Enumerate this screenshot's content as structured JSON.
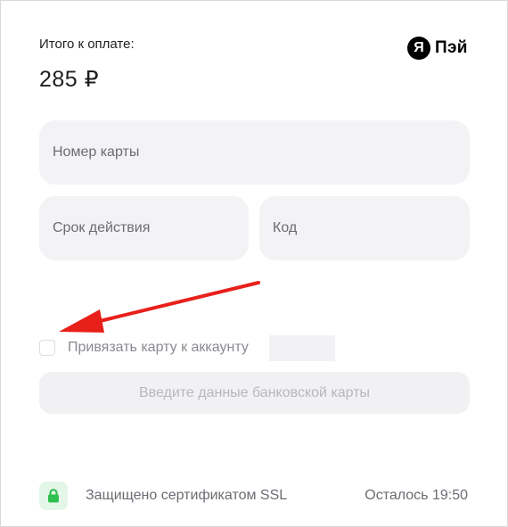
{
  "payment": {
    "amount_label": "Итого к оплате:",
    "amount_value": "285 ₽"
  },
  "brand": {
    "logo_letter": "Я",
    "name": "Пэй"
  },
  "form": {
    "card_number_placeholder": "Номер карты",
    "expiry_placeholder": "Срок действия",
    "cvc_placeholder": "Код",
    "link_card_label": "Привязать карту к аккаунту",
    "link_card_checked": false,
    "submit_label": "Введите данные банковской карты"
  },
  "footer": {
    "ssl_text": "Защищено сертификатом SSL",
    "timer_text": "Осталось 19:50"
  },
  "icons": {
    "ssl": "lock-icon",
    "annotation": "red-arrow-icon"
  },
  "colors": {
    "field_bg": "#f3f3f6",
    "ssl_green": "#2fbf4f",
    "arrow_red": "#e8201a"
  }
}
